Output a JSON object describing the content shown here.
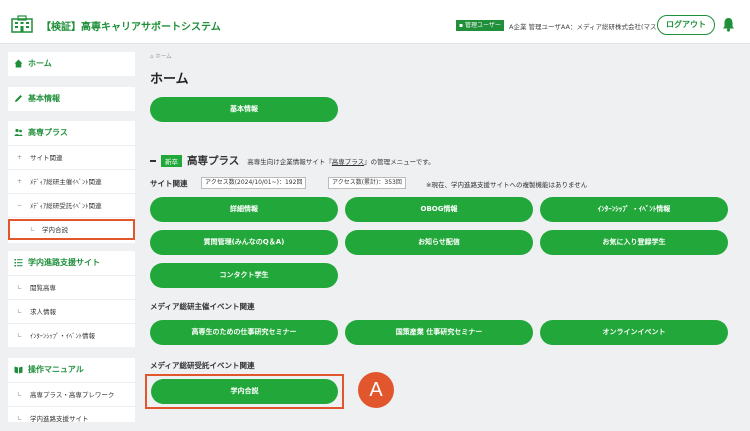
{
  "header": {
    "title": "【検証】高専キャリアサポートシステム",
    "role_badge": "管理ユーザー",
    "user": "A企業 管理ユーザAA：メディア総研株式会社(マスタ)",
    "logout_label": "ログアウト"
  },
  "sidebar": {
    "home": "ホーム",
    "basic_info": "基本情報",
    "kosen_plus": {
      "title": "高専プラス",
      "items": [
        "サイト関連",
        "ﾒﾃﾞｨｱ総研主催ｲﾍﾞﾝﾄ関連",
        "ﾒﾃﾞｨｱ総研受託ｲﾍﾞﾝﾄ関連"
      ],
      "subitem": "学内合説"
    },
    "career_site": {
      "title": "学内進路支援サイト",
      "items": [
        "閲覧高専",
        "求人情報",
        "ｲﾝﾀｰﾝｼｯﾌﾟ・ｲﾍﾞﾝﾄ情報"
      ]
    },
    "manual": {
      "title": "操作マニュアル",
      "items": [
        "高専プラス・高専プレワーク",
        "学内進路支援サイト"
      ]
    }
  },
  "main": {
    "breadcrumb": "ホーム",
    "page_title": "ホーム",
    "basic_info_button": "基本情報",
    "section": {
      "badge": "新卒",
      "title": "高専プラス",
      "desc_prefix": "高専生向け企業情報サイト『",
      "desc_link": "高専プラス",
      "desc_suffix": "』の管理メニューです。"
    },
    "site_related": {
      "label": "サイト関連",
      "access_period": "アクセス数(2024/10/01~)：192回",
      "access_total": "アクセス数(累計)：353回",
      "note": "※現在、学内進路支援サイトへの複製機能はありません",
      "buttons": [
        "詳細情報",
        "OBOG情報",
        "ｲﾝﾀｰﾝｼｯﾌﾟ ・ｲﾍﾞﾝﾄ情報",
        "質問管理(みんなのQ＆A)",
        "お知らせ配信",
        "お気に入り登録学生",
        "コンタクト学生"
      ]
    },
    "hosted_events": {
      "label": "メディア総研主催イベント関連",
      "buttons": [
        "高専生のための仕事研究セミナー",
        "国策産業 仕事研究セミナー",
        "オンラインイベント"
      ]
    },
    "consigned_events": {
      "label": "メディア総研受託イベント関連",
      "button": "学内合説"
    },
    "marker": "A"
  },
  "colors": {
    "accent": "#22a83a",
    "highlight": "#e2562d"
  }
}
